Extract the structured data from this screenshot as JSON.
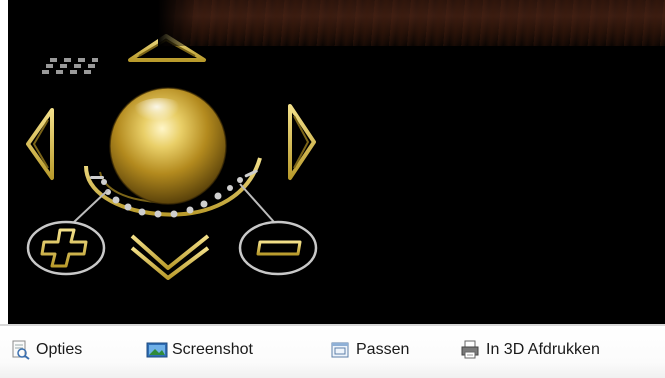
{
  "toolbar": {
    "items": [
      {
        "label": "Opties",
        "icon": "options-icon"
      },
      {
        "label": "Screenshot",
        "icon": "screenshot-icon"
      },
      {
        "label": "Passen",
        "icon": "fit-icon"
      },
      {
        "label": "In 3D Afdrukken",
        "icon": "print-3d-icon"
      }
    ]
  },
  "colors": {
    "gold": "#d9c25a",
    "gold_dark": "#8a7420",
    "silver": "#cfcfcf",
    "viewer_bg": "#000000"
  }
}
